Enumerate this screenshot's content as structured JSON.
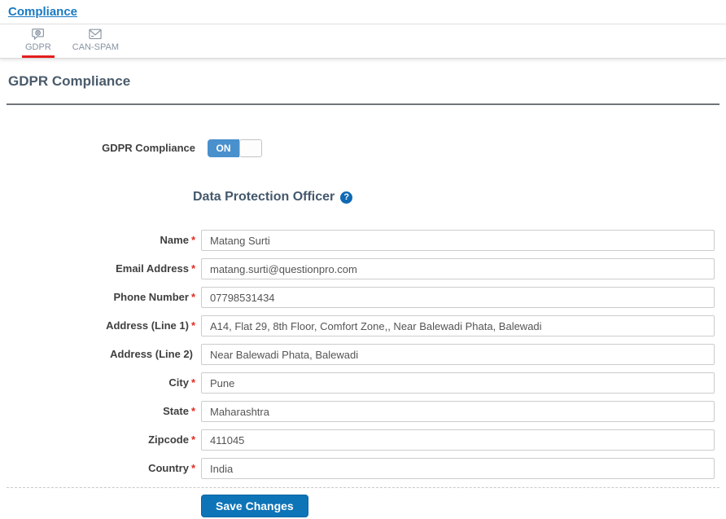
{
  "header": {
    "breadcrumb": "Compliance"
  },
  "tabs": [
    {
      "label": "GDPR",
      "icon": "globe-chat-icon",
      "active": true
    },
    {
      "label": "CAN-SPAM",
      "icon": "envelope-icon",
      "active": false
    }
  ],
  "page": {
    "title": "GDPR Compliance"
  },
  "toggle": {
    "label": "GDPR Compliance",
    "state": "ON"
  },
  "section": {
    "title": "Data Protection Officer",
    "help_glyph": "?",
    "help_icon": "question-circle-icon"
  },
  "form": {
    "fields": [
      {
        "label": "Name",
        "required": "*",
        "value": "Matang Surti"
      },
      {
        "label": "Email Address",
        "required": "*",
        "value": "matang.surti@questionpro.com"
      },
      {
        "label": "Phone Number",
        "required": "*",
        "value": "07798531434"
      },
      {
        "label": "Address (Line 1)",
        "required": "*",
        "value": "A14, Flat 29, 8th Floor, Comfort Zone,, Near Balewadi Phata, Balewadi"
      },
      {
        "label": "Address (Line 2)",
        "required": "",
        "value": "Near Balewadi Phata, Balewadi"
      },
      {
        "label": "City",
        "required": "*",
        "value": "Pune"
      },
      {
        "label": "State",
        "required": "*",
        "value": "Maharashtra"
      },
      {
        "label": "Zipcode",
        "required": "*",
        "value": "411045"
      },
      {
        "label": "Country",
        "required": "*",
        "value": "India"
      }
    ],
    "save_label": "Save Changes"
  },
  "colors": {
    "link_blue": "#1a7ac2",
    "active_tab_red": "#e41e1e",
    "toggle_blue": "#4a90cd",
    "button_blue": "#0e74b8",
    "asterisk_red": "#e02b20",
    "help_icon_blue": "#0f69b4",
    "heading_slate": "#4a5b6b"
  }
}
